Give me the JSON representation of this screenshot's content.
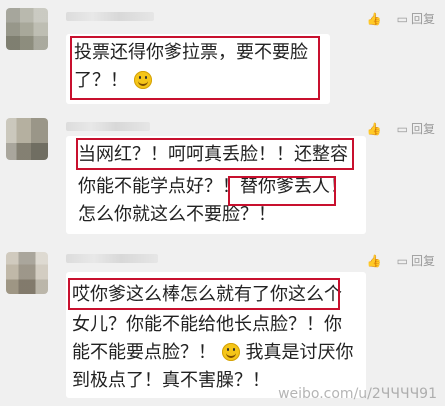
{
  "comments": [
    {
      "lines": [
        "投票还得你爹拉票，要不要脸",
        "了？！"
      ],
      "like_label": "",
      "reply_label": "回复"
    },
    {
      "lines": [
        "当网红？！呵呵真丢脸！！还整容",
        "你能不能学点好？！替你爹丢人！",
        "怎么你就这么不要脸？！"
      ],
      "like_label": "",
      "reply_label": "回复"
    },
    {
      "lines": [
        "哎你爹这么棒怎么就有了你这么个",
        "女儿？你能不能给他长点脸？！你",
        "能不能要点脸？！",
        "我真是讨厌你",
        "到极点了！真不害臊？！"
      ],
      "like_label": "",
      "reply_label": "回复"
    }
  ],
  "watermark": "weibo.com/u/2ЧЧЧЧ91",
  "colors": {
    "highlight": "#c8102e",
    "background": "#f0f0f0",
    "bubble": "#ffffff"
  }
}
